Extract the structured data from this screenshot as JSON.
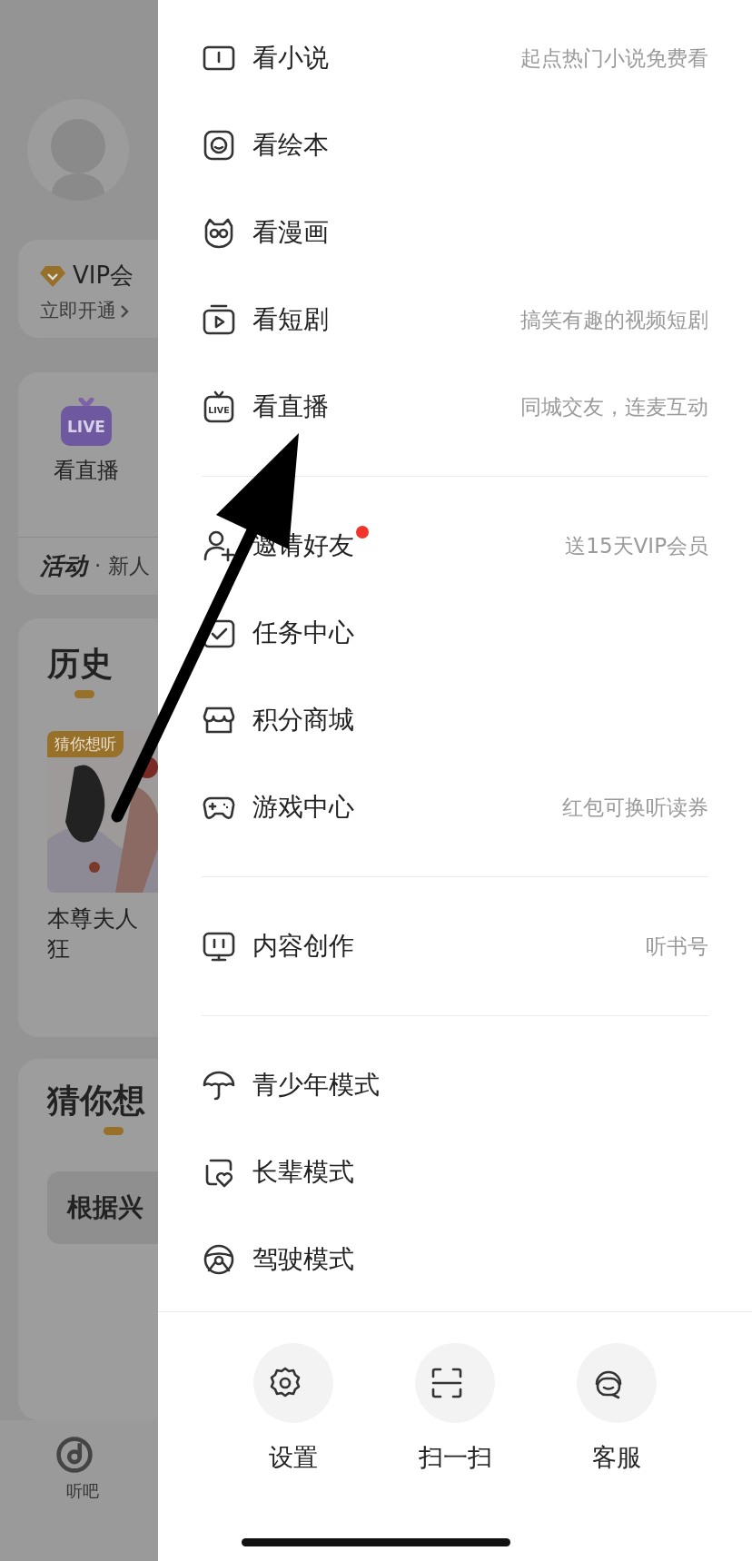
{
  "background_page": {
    "vip": {
      "title": "VIP会",
      "action": "立即开通"
    },
    "feature": {
      "label": "看直播",
      "icon_text": "LIVE"
    },
    "activity": {
      "title": "活动",
      "text": "· 新人"
    },
    "history": {
      "title": "历史",
      "book": {
        "badge": "猜你想听",
        "title_lines": [
          "本尊夫人",
          "狂"
        ]
      }
    },
    "guess": {
      "title": "猜你想",
      "card_text": "根据兴"
    },
    "bottom_nav": [
      {
        "label": "听吧",
        "kind": "disc"
      }
    ]
  },
  "drawer": {
    "groups": [
      {
        "items": [
          {
            "kind": "book",
            "label": "看小说",
            "hint": "起点热门小说免费看",
            "dot": false
          },
          {
            "kind": "face",
            "label": "看绘本",
            "dot": false
          },
          {
            "kind": "owl",
            "label": "看漫画",
            "dot": false
          },
          {
            "kind": "play",
            "label": "看短剧",
            "hint": "搞笑有趣的视频短剧",
            "dot": false
          },
          {
            "kind": "live",
            "icon_text": "LIVE",
            "label": "看直播",
            "hint": "同城交友，连麦互动",
            "dot": false
          }
        ]
      },
      {
        "items": [
          {
            "kind": "adduser",
            "label": "邀请好友",
            "hint": "送15天VIP会员",
            "dot": true
          },
          {
            "kind": "task",
            "label": "任务中心",
            "dot": false
          },
          {
            "kind": "shop",
            "label": "积分商城",
            "dot": false
          },
          {
            "kind": "game",
            "label": "游戏中心",
            "hint": "红包可换听读券",
            "dot": false
          }
        ]
      },
      {
        "items": [
          {
            "kind": "monitor",
            "label": "内容创作",
            "hint": "听书号",
            "dot": false
          }
        ]
      },
      {
        "items": [
          {
            "kind": "umbrella",
            "label": "青少年模式",
            "dot": false
          },
          {
            "kind": "heart",
            "label": "长辈模式",
            "dot": false
          },
          {
            "kind": "wheel",
            "label": "驾驶模式",
            "dot": false
          }
        ]
      }
    ],
    "actions": [
      {
        "kind": "gear",
        "label": "设置"
      },
      {
        "kind": "scan",
        "label": "扫一扫"
      },
      {
        "kind": "headset",
        "label": "客服"
      }
    ]
  }
}
